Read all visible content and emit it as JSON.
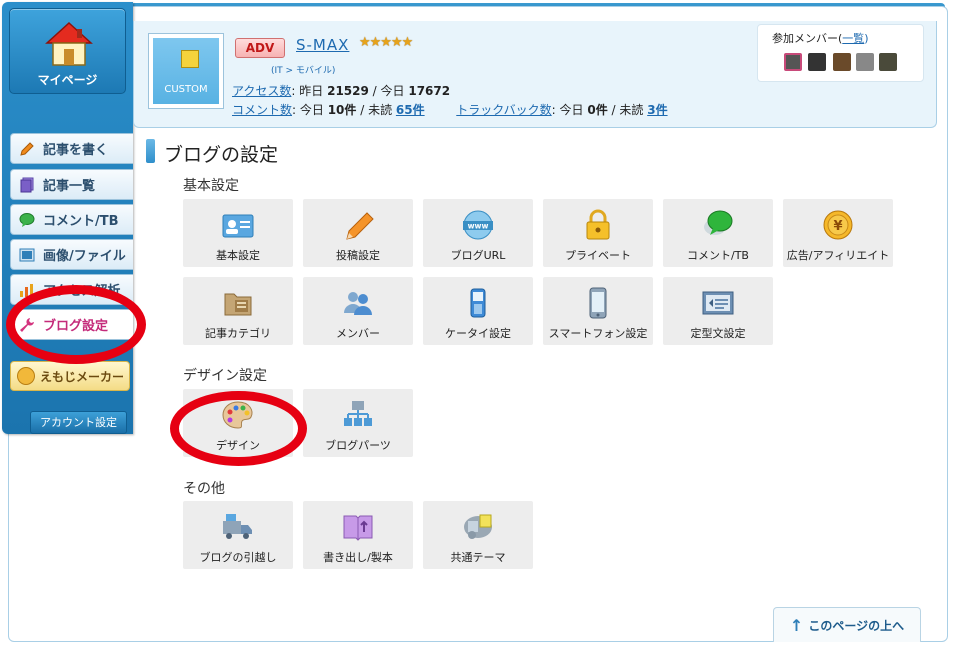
{
  "nav": {
    "mypage_label": "マイページ",
    "items": [
      {
        "label": "記事を書く",
        "color": "#f08a1c"
      },
      {
        "label": "記事一覧",
        "color": "#7a5fc7"
      },
      {
        "label": "コメント/TB",
        "color": "#3bb24a"
      },
      {
        "label": "画像/ファイル",
        "color": "#2f7fb8"
      },
      {
        "label": "アクセス解析",
        "color": "#e8a41c"
      },
      {
        "label": "ブログ設定",
        "color": "#d4347e"
      }
    ],
    "emoji_label": "えもじメーカー",
    "account_label": "アカウント設定"
  },
  "header": {
    "thumb_text": "CUSTOM",
    "adv_badge": "ADV",
    "blog_name": "S-MAX",
    "stars": "★★★★★",
    "category": "(IT > モバイル)",
    "access_label": "アクセス数",
    "access_text": ": 昨日 ",
    "yesterday": "21529",
    "today_text": " / 今日 ",
    "today": "17672",
    "comment_label": "コメント数",
    "comment_text": ": 今日 ",
    "comment_today": "10件",
    "comment_unread_text": " / 未読 ",
    "comment_unread": "65件",
    "trackback_label": "トラックバック数",
    "trackback_text": ": 今日 ",
    "trackback_today": "0件",
    "trackback_unread_text": " / 未読 ",
    "trackback_unread": "3件",
    "members_title": "参加メンバー(",
    "members_link": "一覧",
    "members_close": ")"
  },
  "main": {
    "title": "ブログの設定",
    "sections": [
      {
        "title": "基本設定",
        "tiles": [
          {
            "label": "基本設定",
            "icon": "id-card-icon"
          },
          {
            "label": "投稿設定",
            "icon": "pencil-icon"
          },
          {
            "label": "ブログURL",
            "icon": "www-globe-icon"
          },
          {
            "label": "プライベート",
            "icon": "lock-icon"
          },
          {
            "label": "コメント/TB",
            "icon": "speech-bubble-icon"
          },
          {
            "label": "広告/アフィリエイト",
            "icon": "yen-coin-icon"
          },
          {
            "label": "記事カテゴリ",
            "icon": "folder-icon"
          },
          {
            "label": "メンバー",
            "icon": "members-icon"
          },
          {
            "label": "ケータイ設定",
            "icon": "feature-phone-icon"
          },
          {
            "label": "スマートフォン設定",
            "icon": "smartphone-icon"
          },
          {
            "label": "定型文設定",
            "icon": "template-text-icon"
          }
        ]
      },
      {
        "title": "デザイン設定",
        "tiles": [
          {
            "label": "デザイン",
            "icon": "palette-icon"
          },
          {
            "label": "ブログパーツ",
            "icon": "blog-parts-icon"
          }
        ]
      },
      {
        "title": "その他",
        "tiles": [
          {
            "label": "ブログの引越し",
            "icon": "moving-truck-icon"
          },
          {
            "label": "書き出し/製本",
            "icon": "book-export-icon"
          },
          {
            "label": "共通テーマ",
            "icon": "shared-theme-icon"
          }
        ]
      }
    ]
  },
  "pagetop_label": "このページの上へ",
  "colors": {
    "accent": "#1e6ab0",
    "highlight_circle": "#e60012"
  }
}
